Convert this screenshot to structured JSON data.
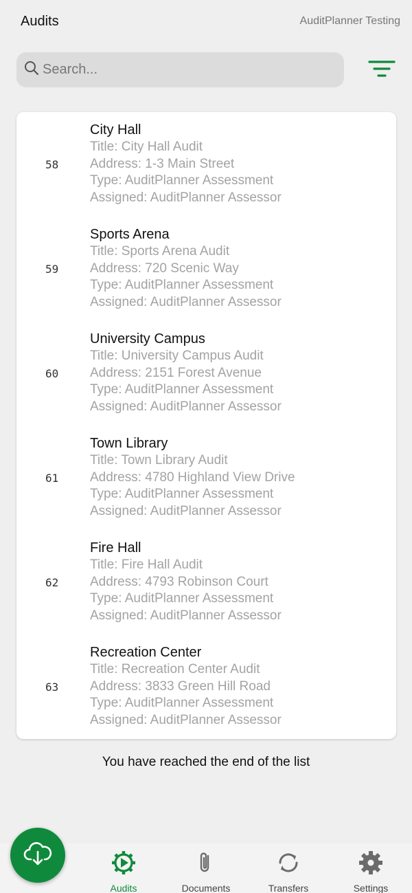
{
  "header": {
    "title": "Audits",
    "org": "AuditPlanner Testing"
  },
  "search": {
    "placeholder": "Search...",
    "icon": "search-icon"
  },
  "filter": {
    "icon": "filter-icon",
    "color": "#0f8a3c"
  },
  "audits": [
    {
      "id": "58",
      "name": "City Hall",
      "title": "Title: City Hall Audit",
      "address": "Address: 1-3 Main Street",
      "type": "Type: AuditPlanner Assessment",
      "assigned": "Assigned: AuditPlanner Assessor"
    },
    {
      "id": "59",
      "name": "Sports Arena",
      "title": "Title: Sports Arena Audit",
      "address": "Address: 720 Scenic Way",
      "type": "Type: AuditPlanner Assessment",
      "assigned": "Assigned: AuditPlanner Assessor"
    },
    {
      "id": "60",
      "name": "University Campus",
      "title": "Title: University Campus Audit",
      "address": "Address: 2151 Forest Avenue",
      "type": "Type: AuditPlanner Assessment",
      "assigned": "Assigned: AuditPlanner Assessor"
    },
    {
      "id": "61",
      "name": "Town Library",
      "title": "Title: Town Library Audit",
      "address": "Address: 4780 Highland View Drive",
      "type": "Type: AuditPlanner Assessment",
      "assigned": "Assigned: AuditPlanner Assessor"
    },
    {
      "id": "62",
      "name": "Fire Hall",
      "title": "Title: Fire Hall Audit",
      "address": "Address: 4793 Robinson Court",
      "type": "Type: AuditPlanner Assessment",
      "assigned": "Assigned: AuditPlanner Assessor"
    },
    {
      "id": "63",
      "name": "Recreation Center",
      "title": "Title: Recreation Center Audit",
      "address": "Address: 3833 Green Hill Road",
      "type": "Type: AuditPlanner Assessment",
      "assigned": "Assigned: AuditPlanner Assessor"
    }
  ],
  "end_of_list": "You have reached the end of the list",
  "fab": {
    "icon": "cloud-download-icon",
    "color": "#0f8a3c"
  },
  "nav": {
    "active_color": "#0f8a3c",
    "items": [
      {
        "label": "Audits",
        "icon": "audits-gear-play-icon",
        "active": true
      },
      {
        "label": "Documents",
        "icon": "paperclip-icon",
        "active": false
      },
      {
        "label": "Transfers",
        "icon": "sync-icon",
        "active": false
      },
      {
        "label": "Settings",
        "icon": "settings-gear-icon",
        "active": false
      }
    ]
  }
}
